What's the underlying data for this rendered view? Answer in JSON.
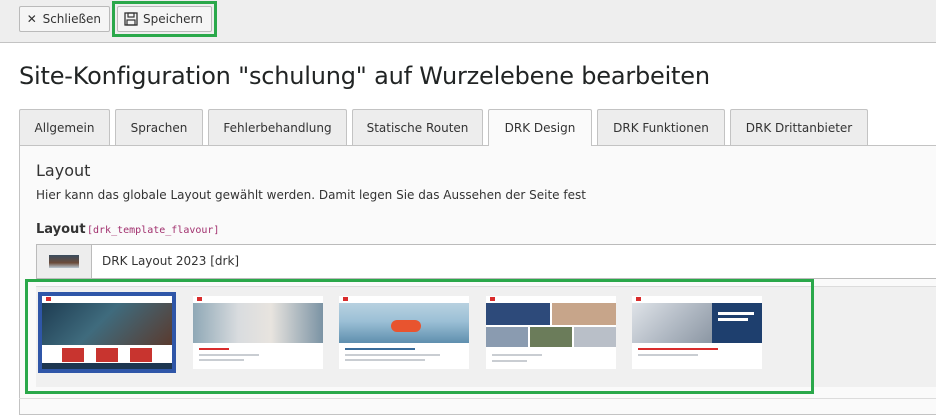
{
  "toolbar": {
    "close_label": "Schließen",
    "save_label": "Speichern"
  },
  "page": {
    "title": "Site-Konfiguration \"schulung\" auf Wurzelebene bearbeiten"
  },
  "tabs": [
    {
      "label": "Allgemein"
    },
    {
      "label": "Sprachen"
    },
    {
      "label": "Fehlerbehandlung"
    },
    {
      "label": "Statische Routen"
    },
    {
      "label": "DRK Design",
      "active": true
    },
    {
      "label": "DRK Funktionen"
    },
    {
      "label": "DRK Drittanbieter"
    }
  ],
  "section": {
    "title": "Layout",
    "description": "Hier kann das globale Layout gewählt werden. Damit legen Sie das Aussehen der Seite fest"
  },
  "field": {
    "label": "Layout",
    "code": "[drk_template_flavour]",
    "selected_value": "DRK Layout 2023 [drk]"
  },
  "gallery": {
    "items": [
      {
        "selected": true
      },
      {
        "selected": false
      },
      {
        "selected": false
      },
      {
        "selected": false
      },
      {
        "selected": false
      }
    ]
  },
  "colors": {
    "highlight": "#2aa84a",
    "selection": "#2f56a8",
    "drk_red": "#d92c2c"
  },
  "icons": {
    "close": "close-icon",
    "save": "floppy-disk-icon"
  }
}
